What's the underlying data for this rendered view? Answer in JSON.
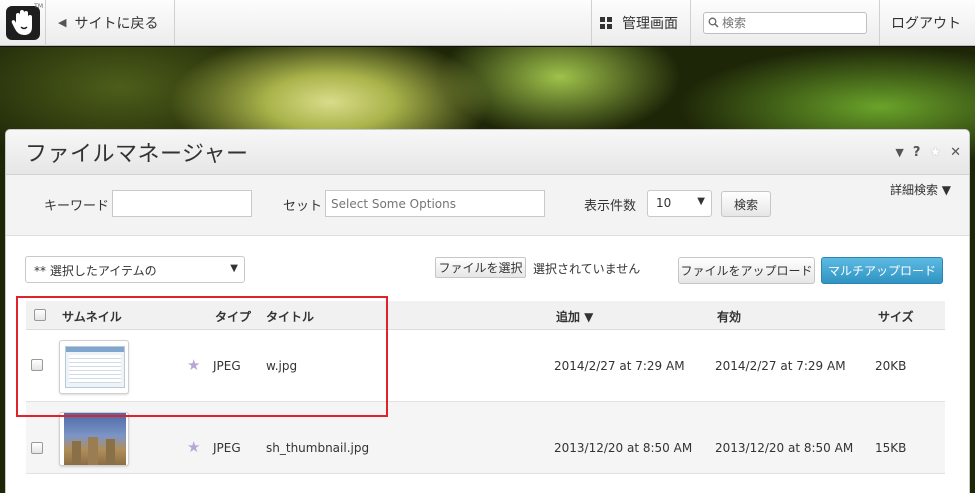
{
  "topbar": {
    "back_label": "サイトに戻る",
    "admin_label": "管理画面",
    "search_placeholder": "検索",
    "logout_label": "ログアウト",
    "logo_tm": "TM"
  },
  "dialog": {
    "title": "ファイルマネージャー",
    "controls": {
      "help_menu": "▼",
      "help": "?",
      "favorite": "★",
      "close": "✕"
    },
    "filter": {
      "keyword_label": "キーワード",
      "keyword_value": "",
      "set_label": "セット",
      "set_placeholder": "Select Some Options",
      "count_label": "表示件数",
      "count_value": "10",
      "search_button": "検索",
      "advanced_search": "詳細検索 ▼"
    },
    "actions": {
      "bulk_select": "** 選択したアイテムの",
      "choose_file_button": "ファイルを選択",
      "no_file_selected": "選択されていません",
      "upload_button": "ファイルをアップロード",
      "multi_upload_button": "マルチアップロード"
    },
    "table": {
      "columns": {
        "thumbnail": "サムネイル",
        "type": "タイプ",
        "title": "タイトル",
        "added": "追加 ▼",
        "active": "有効",
        "size": "サイズ"
      },
      "rows": [
        {
          "type": "JPEG",
          "title": "w.jpg",
          "added": "2014/2/27 at 7:29 AM",
          "active": "2014/2/27 at 7:29 AM",
          "size": "20KB"
        },
        {
          "type": "JPEG",
          "title": "sh_thumbnail.jpg",
          "added": "2013/12/20 at 8:50 AM",
          "active": "2013/12/20 at 8:50 AM",
          "size": "15KB"
        }
      ]
    }
  },
  "colors": {
    "accent_blue": "#3a9fcc",
    "highlight_red": "#e0232a",
    "star_purple": "#b6a7d7"
  }
}
